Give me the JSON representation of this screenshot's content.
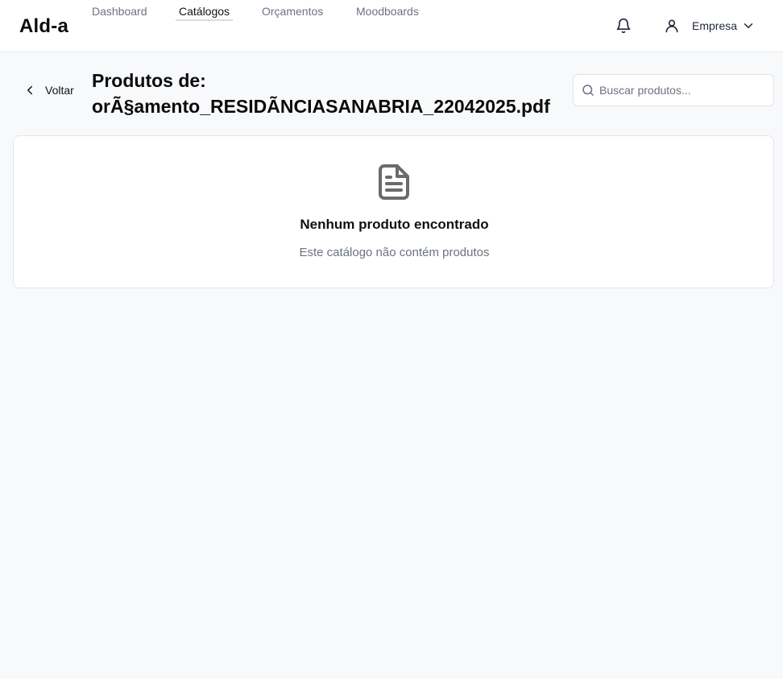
{
  "app": {
    "logo": "Ald-a"
  },
  "nav": {
    "items": [
      {
        "label": "Dashboard",
        "active": false
      },
      {
        "label": "Catálogos",
        "active": true
      },
      {
        "label": "Orçamentos",
        "active": false
      },
      {
        "label": "Moodboards",
        "active": false
      }
    ]
  },
  "header": {
    "notifications_icon": "bell-icon",
    "user_icon": "user-icon",
    "user_label": "Empresa",
    "user_menu_icon": "chevron-down-icon"
  },
  "page": {
    "back_label": "Voltar",
    "back_icon": "chevron-left-icon",
    "title_prefix": "Produtos de:",
    "title_file": "orÃ§amento_RESIDÃNCIASANABRIA_22042025.pdf"
  },
  "search": {
    "placeholder": "Buscar produtos...",
    "value": "",
    "icon": "search-icon"
  },
  "empty_state": {
    "icon": "file-text-icon",
    "title": "Nenhum produto encontrado",
    "subtitle": "Este catálogo não contém produtos"
  },
  "colors": {
    "background": "#f8f9fb",
    "surface": "#ffffff",
    "muted_text": "#6b7280",
    "icon_gray": "#6b6b6b"
  }
}
